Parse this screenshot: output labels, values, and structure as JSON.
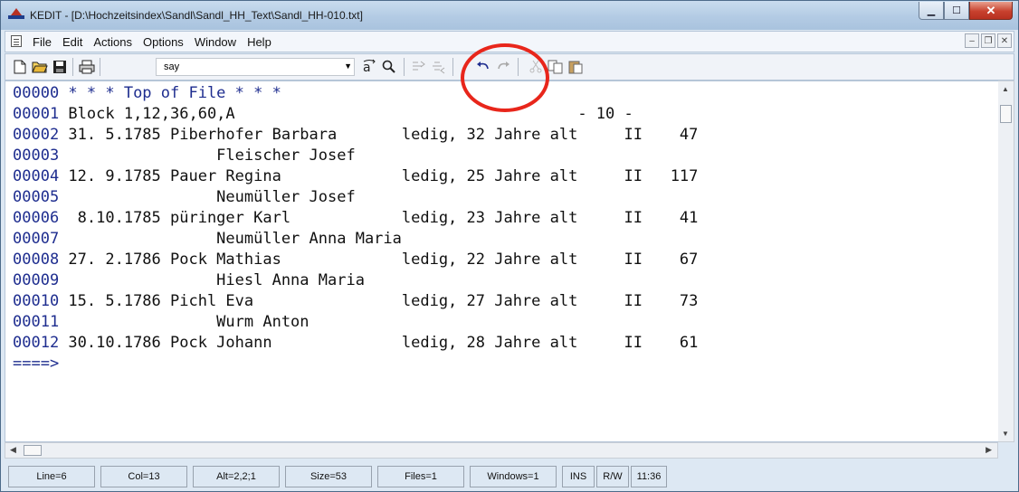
{
  "window": {
    "title": "KEDIT - [D:\\Hochzeitsindex\\Sandl\\Sandl_HH_Text\\Sandl_HH-010.txt]",
    "minimize_icon": "minimize-icon",
    "maximize_icon": "maximize-icon",
    "close_icon": "close-icon"
  },
  "menu": {
    "items": [
      "File",
      "Edit",
      "Actions",
      "Options",
      "Window",
      "Help"
    ]
  },
  "toolbar": {
    "search_value": "say",
    "icons": [
      "new-file-icon",
      "open-folder-icon",
      "save-icon",
      "print-icon",
      "find-icon",
      "search-icon",
      "undo-icon",
      "redo-icon",
      "copy-icon",
      "paste-icon"
    ]
  },
  "editor": {
    "lines": [
      {
        "num": "00000",
        "text": " * * * Top of File * * *"
      },
      {
        "num": "00001",
        "text": " Block 1,12,36,60,A                                     - 10 -"
      },
      {
        "num": "00002",
        "text": " 31. 5.1785 Piberhofer Barbara       ledig, 32 Jahre alt     II    47"
      },
      {
        "num": "00003",
        "text": "                 Fleischer Josef"
      },
      {
        "num": "00004",
        "text": " 12. 9.1785 Pauer Regina             ledig, 25 Jahre alt     II   117"
      },
      {
        "num": "00005",
        "text": "                 Neumüller Josef"
      },
      {
        "num": "00006",
        "text": "  8.10.1785 püringer Karl            ledig, 23 Jahre alt     II    41"
      },
      {
        "num": "00007",
        "text": "                 Neumüller Anna Maria"
      },
      {
        "num": "00008",
        "text": " 27. 2.1786 Pock Mathias             ledig, 22 Jahre alt     II    67"
      },
      {
        "num": "00009",
        "text": "                 Hiesl Anna Maria"
      },
      {
        "num": "00010",
        "text": " 15. 5.1786 Pichl Eva                ledig, 27 Jahre alt     II    73"
      },
      {
        "num": "00011",
        "text": "                 Wurm Anton"
      },
      {
        "num": "00012",
        "text": " 30.10.1786 Pock Johann              ledig, 28 Jahre alt     II    61"
      }
    ],
    "command_line": "====>"
  },
  "status": {
    "line": "Line=6",
    "col": "Col=13",
    "alt": "Alt=2,2;1",
    "size": "Size=53",
    "files": "Files=1",
    "windows": "Windows=1",
    "ins": "INS",
    "rw": "R/W",
    "time": "11:36"
  },
  "colors": {
    "annotation_circle": "#e8261b",
    "line_number": "#1e2d8f"
  }
}
